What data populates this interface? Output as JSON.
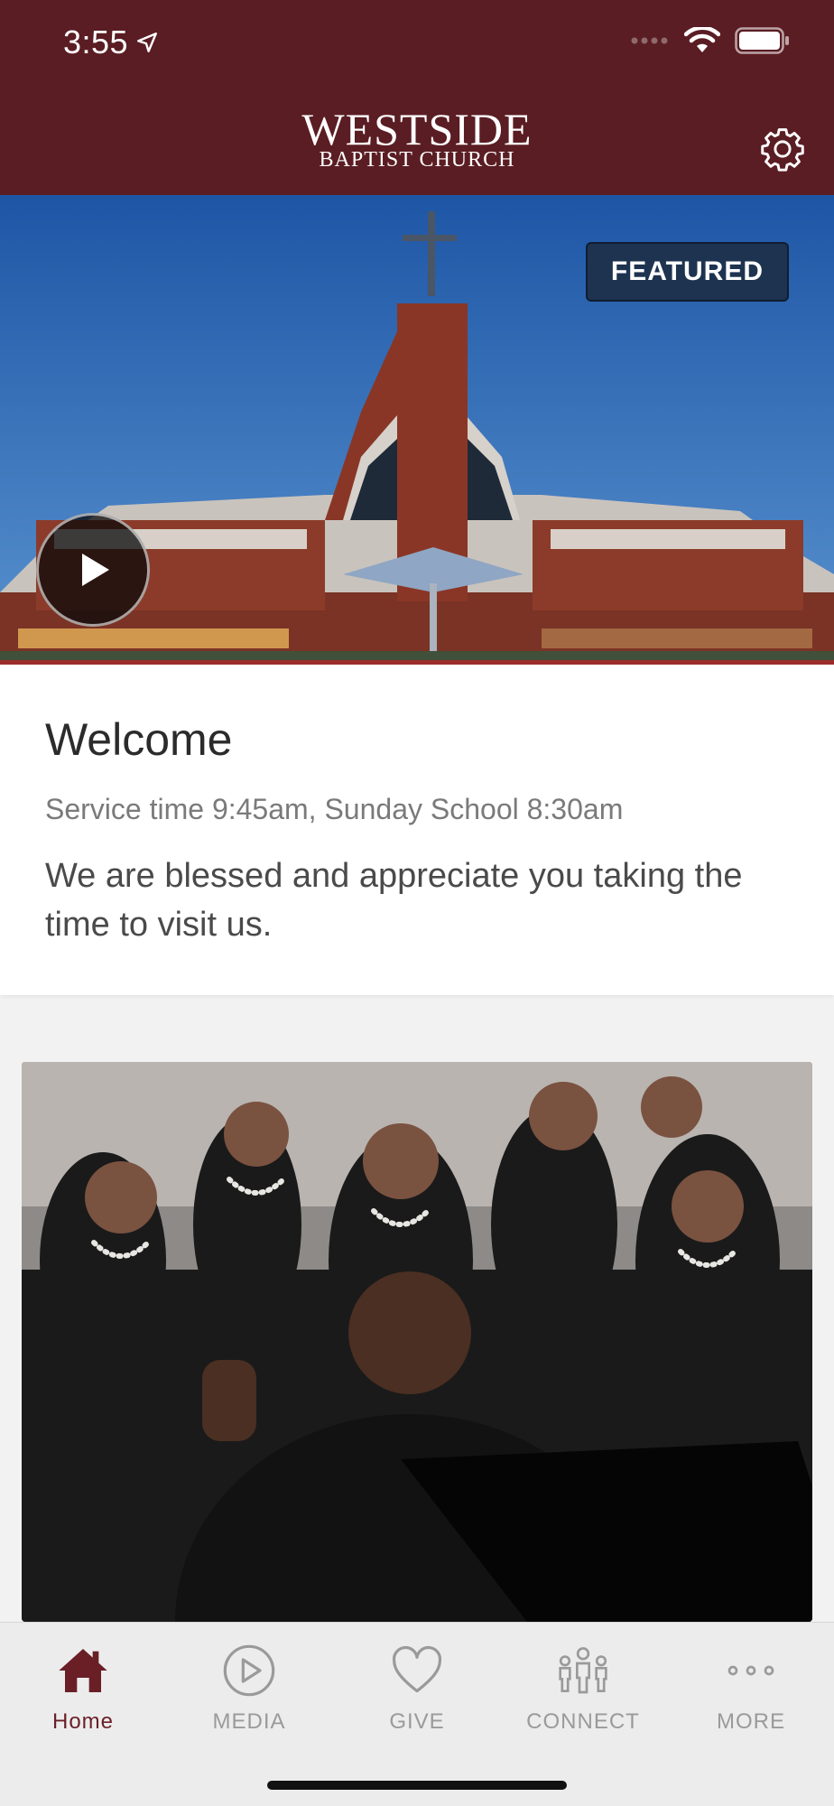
{
  "status_bar": {
    "time": "3:55"
  },
  "header": {
    "logo_main": "WESTSIDE",
    "logo_sub": "BAPTIST CHURCH",
    "settings_icon": "gear-icon"
  },
  "hero": {
    "badge": "FEATURED",
    "play_icon": "play-icon"
  },
  "welcome": {
    "title": "Welcome",
    "subtitle": "Service time 9:45am, Sunday School 8:30am",
    "body": "We are blessed and appreciate you taking the time to visit us."
  },
  "tabs": [
    {
      "label": "Home",
      "icon": "home-icon",
      "active": true
    },
    {
      "label": "MEDIA",
      "icon": "play-circle-icon",
      "active": false
    },
    {
      "label": "GIVE",
      "icon": "heart-icon",
      "active": false
    },
    {
      "label": "CONNECT",
      "icon": "people-icon",
      "active": false
    },
    {
      "label": "MORE",
      "icon": "more-icon",
      "active": false
    }
  ],
  "colors": {
    "brand": "#5a1d23",
    "active_tab": "#6a1f27",
    "badge": "#1e3350"
  }
}
